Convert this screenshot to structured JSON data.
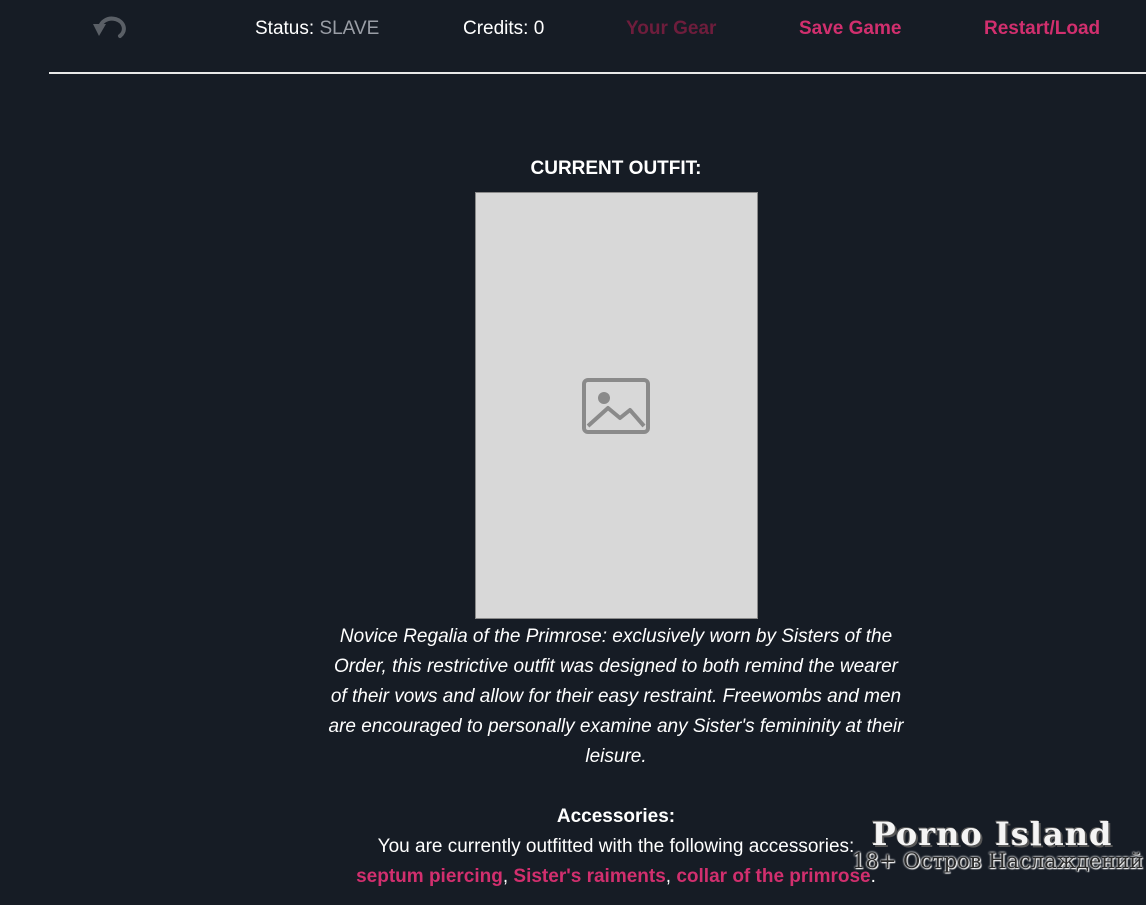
{
  "header": {
    "undo_icon": "undo-arrow-icon",
    "status_label": "Status:",
    "status_value": "SLAVE",
    "credits_label": "Credits:",
    "credits_value": "0",
    "gear_label": "Your Gear",
    "save_label": "Save Game",
    "restart_label": "Restart/Load"
  },
  "colors": {
    "background": "#161c25",
    "link": "#d12f6e",
    "link_disabled": "#6e1d3c",
    "status_value": "#9a9ea6"
  },
  "main": {
    "heading": "CURRENT OUTFIT:",
    "photo_icon": "image-placeholder-icon",
    "description": "Novice Regalia of the Primrose: exclusively worn by Sisters of the Order, this restrictive outfit was designed to both remind the wearer of their vows and allow for their easy restraint. Freewombs and men are encouraged to personally examine any Sister's femininity at their leisure.",
    "accessories_heading": "Accessories:",
    "accessories_intro": "You are currently outfitted with the following accessories:",
    "accessories": [
      "septum piercing",
      "Sister's raiments",
      "collar of the primrose"
    ],
    "separator": ", ",
    "terminator": "."
  },
  "watermark": {
    "title": "Porno Island",
    "subtitle": "18+ Остров Наслаждений"
  }
}
